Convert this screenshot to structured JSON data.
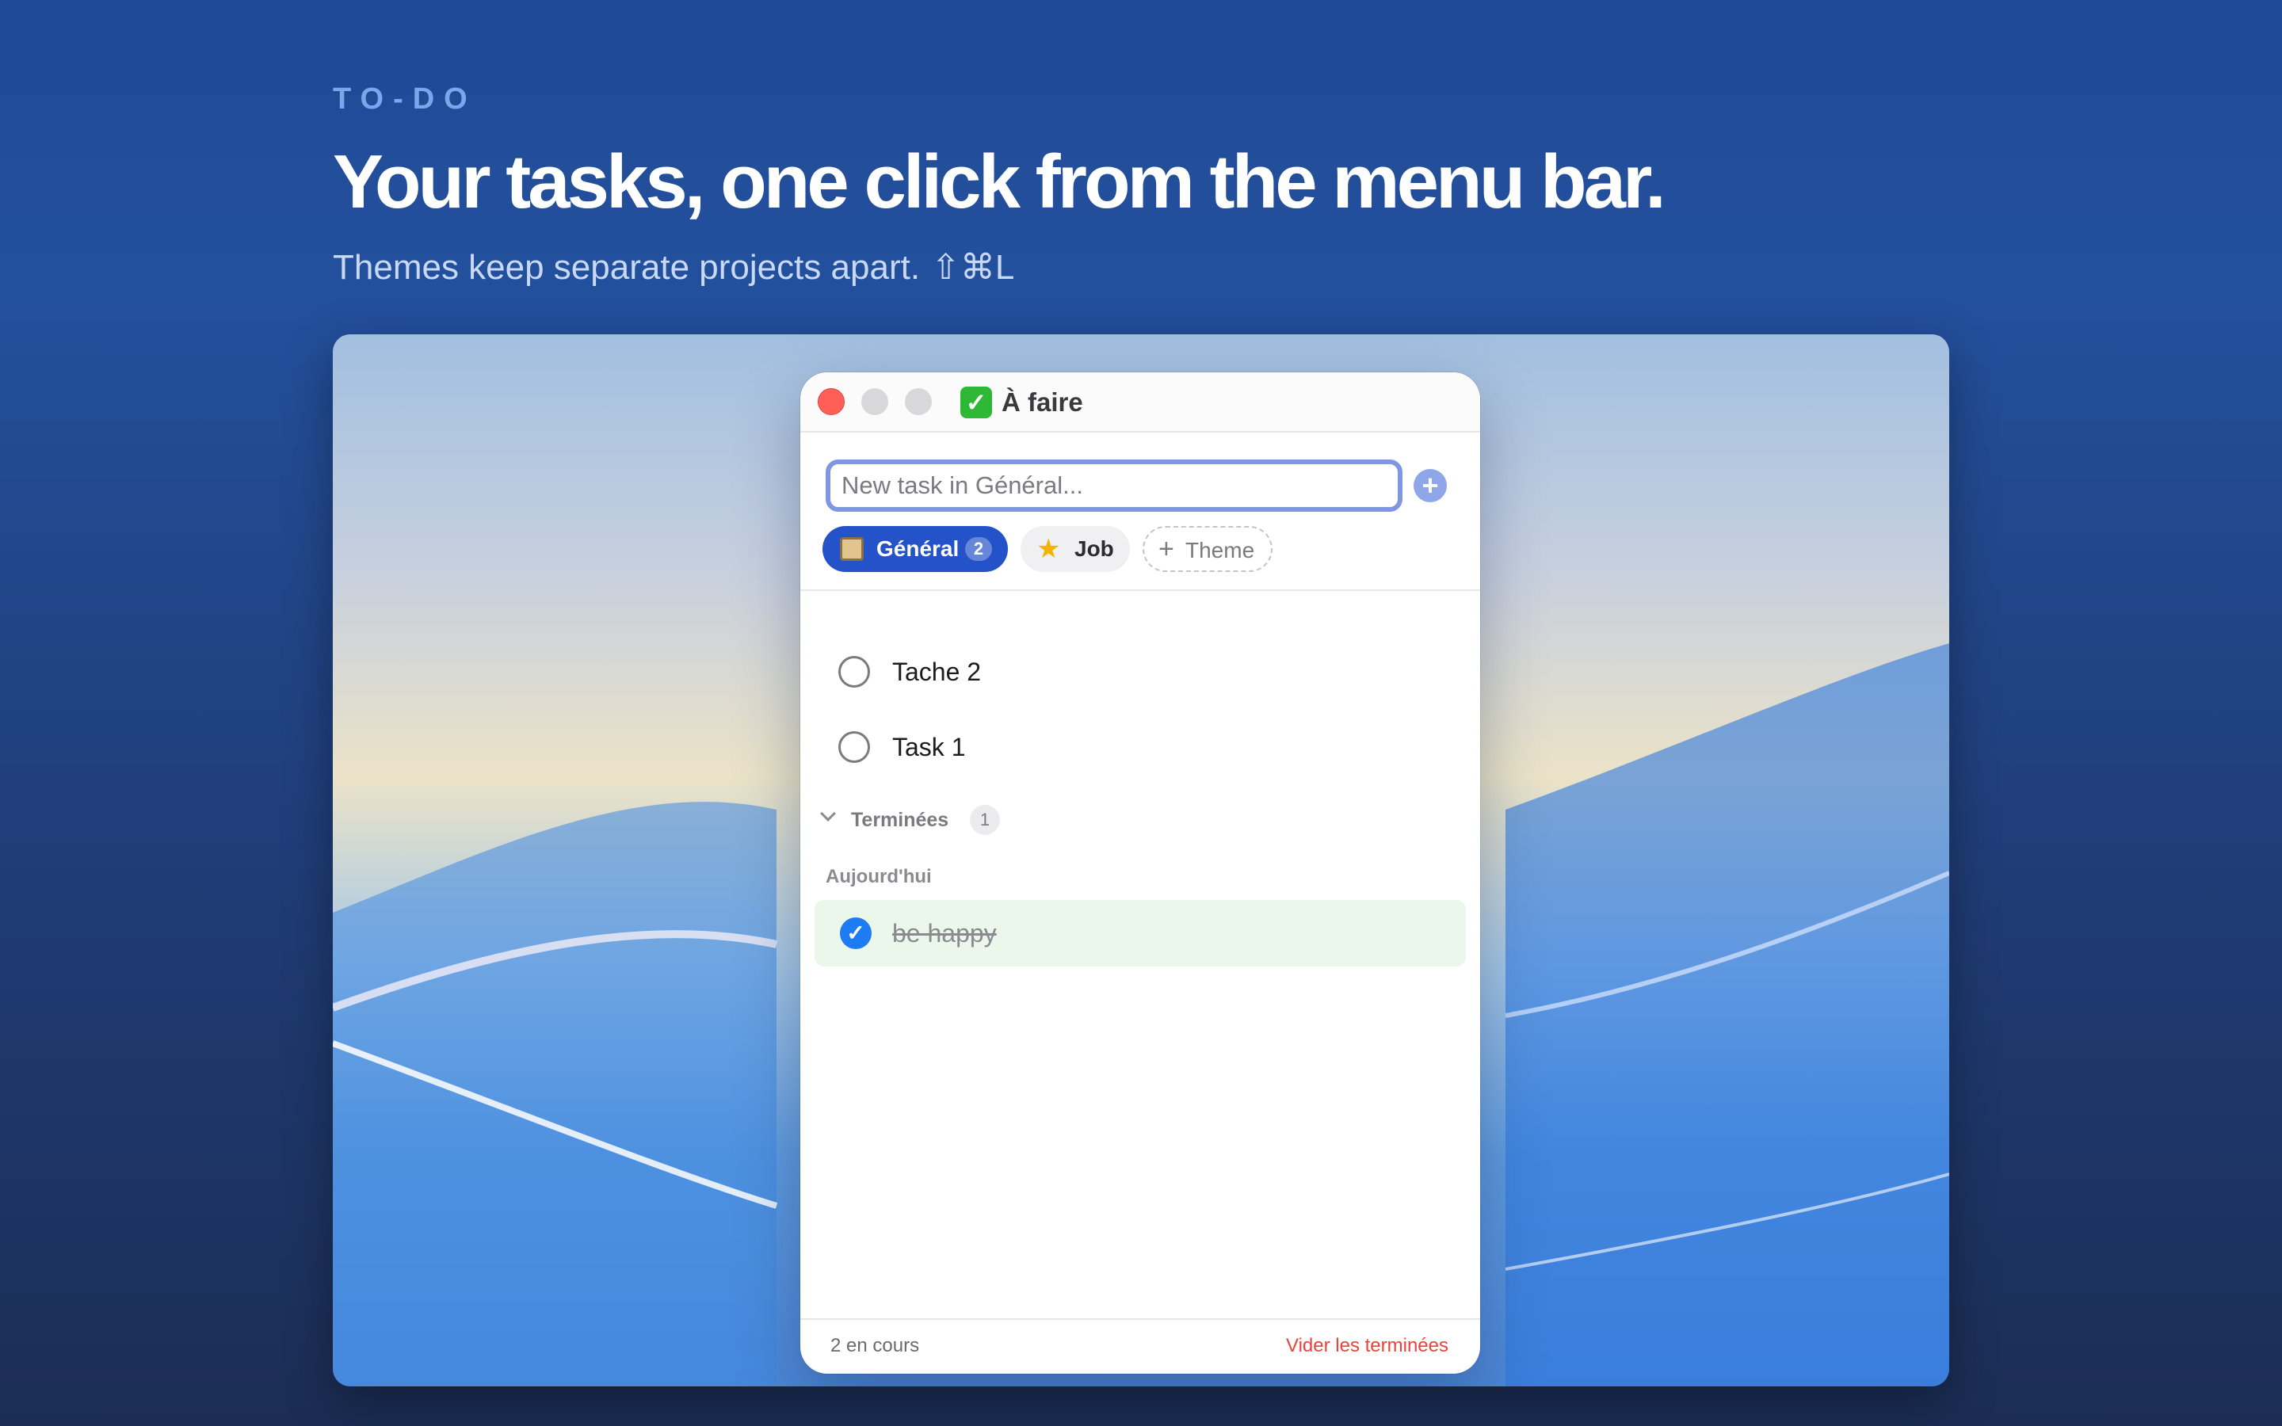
{
  "hero": {
    "eyebrow": "TO-DO",
    "headline": "Your tasks, one click from the menu bar.",
    "subline": "Themes keep separate projects apart.",
    "shortcut": "⇧⌘L"
  },
  "window": {
    "title": "À faire",
    "title_icon": "checkmark-icon"
  },
  "composer": {
    "placeholder": "New task in Général...",
    "value": "",
    "add_icon": "plus-icon"
  },
  "themes": [
    {
      "label": "Général",
      "count": "2",
      "icon": "clipboard-icon",
      "selected": true
    },
    {
      "label": "Job",
      "icon": "star-icon",
      "selected": false
    }
  ],
  "add_theme": {
    "label": "Theme",
    "icon": "plus-icon"
  },
  "tasks": [
    {
      "label": "Tache 2",
      "done": false
    },
    {
      "label": "Task 1",
      "done": false
    }
  ],
  "completed": {
    "header": "Terminées",
    "count": "1",
    "group": "Aujourd'hui",
    "items": [
      {
        "label": "be happy",
        "done": true
      }
    ]
  },
  "footer": {
    "status": "2 en cours",
    "clear": "Vider les terminées"
  },
  "colors": {
    "accent": "#2352c9",
    "close": "#ff5f57",
    "check": "#1d7cf2",
    "danger": "#e8433c",
    "done_bg": "#ebf7ea"
  }
}
